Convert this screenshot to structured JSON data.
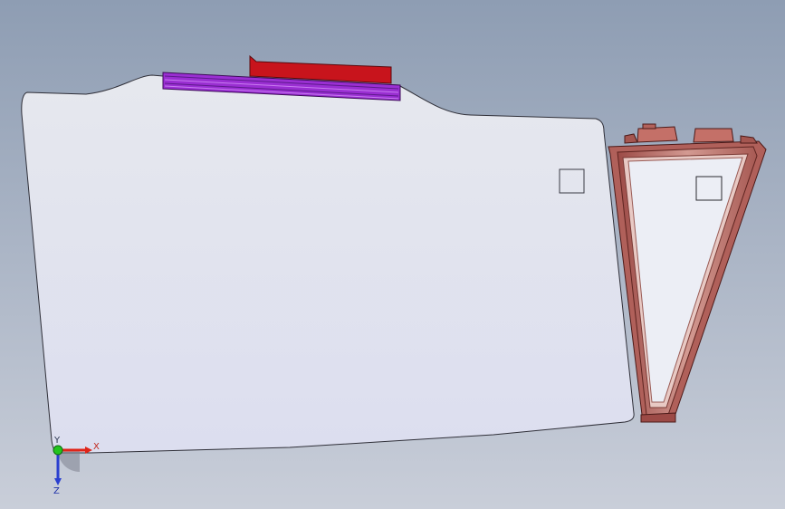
{
  "viewport": {
    "background_top": "#8e9db3",
    "background_bottom": "#c9ced9"
  },
  "triad": {
    "x_label": "X",
    "y_label": "Y",
    "z_label": "Z",
    "x_color": "#e02418",
    "y_color": "#22c41e",
    "z_color": "#2a3fd0"
  },
  "colors": {
    "main_body": "#e4e6ee",
    "red_part": "#c8141c",
    "purple_part": "#9a2fd2",
    "frame_part": "#b0605a",
    "frame_inner": "#e8c9c4"
  }
}
